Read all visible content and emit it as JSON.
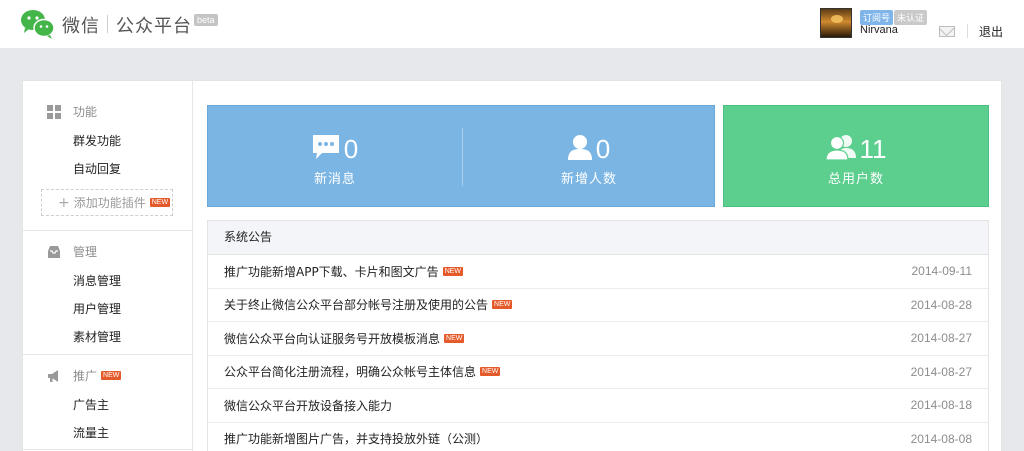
{
  "header": {
    "brand_main": "微信",
    "brand_sub": "公众平台",
    "beta_badge": "beta",
    "account_type_badge": "订阅号",
    "verify_badge": "未认证",
    "username": "Nirvana",
    "logout_label": "退出"
  },
  "sidebar": {
    "sections": [
      {
        "title": "功能",
        "icon": "grid-icon",
        "items": [
          "群发功能",
          "自动回复"
        ]
      },
      {
        "title": "管理",
        "icon": "inbox-icon",
        "items": [
          "消息管理",
          "用户管理",
          "素材管理"
        ]
      },
      {
        "title": "推广",
        "icon": "megaphone-icon",
        "new_tag": "NEW",
        "items": [
          "广告主",
          "流量主"
        ]
      }
    ],
    "add_plugin_label": "添加功能插件",
    "add_plugin_new_tag": "NEW"
  },
  "stats": {
    "new_messages": {
      "value": "0",
      "label": "新消息"
    },
    "new_users": {
      "value": "0",
      "label": "新增人数"
    },
    "total_users": {
      "value": "11",
      "label": "总用户数"
    }
  },
  "announcements": {
    "title": "系统公告",
    "new_tag": "NEW",
    "rows": [
      {
        "title": "推广功能新增APP下载、卡片和图文广告",
        "date": "2014-09-11",
        "is_new": true
      },
      {
        "title": "关于终止微信公众平台部分帐号注册及使用的公告",
        "date": "2014-08-28",
        "is_new": true
      },
      {
        "title": "微信公众平台向认证服务号开放模板消息",
        "date": "2014-08-27",
        "is_new": true
      },
      {
        "title": "公众平台简化注册流程，明确公众帐号主体信息",
        "date": "2014-08-27",
        "is_new": true
      },
      {
        "title": "微信公众平台开放设备接入能力",
        "date": "2014-08-18",
        "is_new": false
      },
      {
        "title": "推广功能新增图片广告，并支持投放外链（公测）",
        "date": "2014-08-08",
        "is_new": false
      }
    ]
  },
  "colors": {
    "stat_blue": "#7bb5e3",
    "stat_green": "#5ccf8e",
    "new_tag": "#e45a2a",
    "logo_green": "#44b549"
  }
}
